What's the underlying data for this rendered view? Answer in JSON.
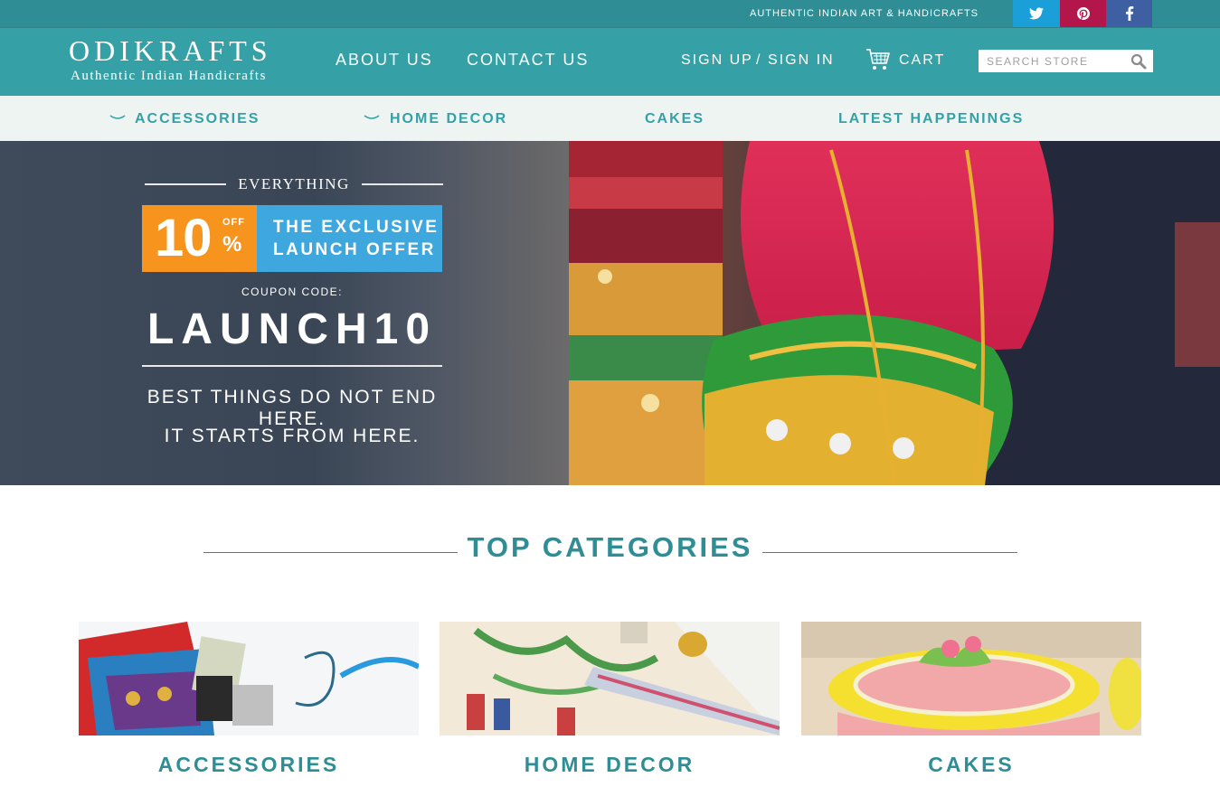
{
  "topbar": {
    "tagline": "AUTHENTIC INDIAN ART & HANDICRAFTS",
    "social": [
      {
        "name": "twitter",
        "icon": "twitter-icon",
        "color": "#1b9fd8"
      },
      {
        "name": "pinterest",
        "icon": "pinterest-icon",
        "color": "#b2164a"
      },
      {
        "name": "facebook",
        "icon": "facebook-icon",
        "color": "#3e5fa2"
      }
    ]
  },
  "header": {
    "logo_main": "ODIKRAFTS",
    "logo_sub": "Authentic Indian Handicrafts",
    "nav": {
      "about": "ABOUT US",
      "contact": "CONTACT US",
      "signup": "SIGN UP",
      "slash": "/",
      "signin": "SIGN IN",
      "cart": "CART"
    },
    "search_placeholder": "SEARCH STORE",
    "brand_color": "#35a1a6"
  },
  "category_nav": {
    "items": [
      "ACCESSORIES",
      "HOME DECOR",
      "CAKES",
      "LATEST HAPPENINGS"
    ]
  },
  "banner": {
    "everything": "EVERYTHING",
    "percent": "10",
    "off": "OFF",
    "percent_sign": "%",
    "exclusive": "THE EXCLUSIVE LAUNCH OFFER",
    "coupon_label": "COUPON CODE:",
    "coupon_code": "LAUNCH10",
    "line1": "BEST THINGS DO NOT END HERE.",
    "line2": "IT STARTS FROM HERE.",
    "orange": "#f7941d",
    "blue": "#3ea7de"
  },
  "top_categories": {
    "title": "TOP CATEGORIES",
    "cards": [
      {
        "label": "ACCESSORIES"
      },
      {
        "label": "HOME DECOR"
      },
      {
        "label": "CAKES"
      }
    ]
  }
}
